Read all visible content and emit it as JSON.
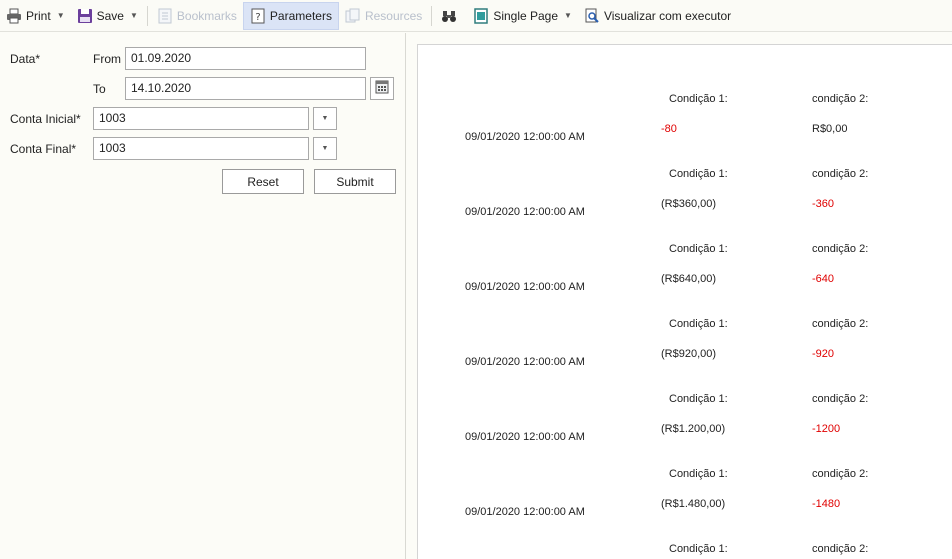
{
  "toolbar": {
    "print": "Print",
    "save": "Save",
    "bookmarks": "Bookmarks",
    "parameters": "Parameters",
    "resources": "Resources",
    "single_page": "Single Page",
    "run": "Visualizar com executor"
  },
  "params": {
    "data_label": "Data*",
    "from_label": "From",
    "from_value": "01.09.2020",
    "to_label": "To",
    "to_value": "14.10.2020",
    "conta_inicial_label": "Conta Inicial*",
    "conta_inicial_value": "1003",
    "conta_final_label": "Conta Final*",
    "conta_final_value": "1003",
    "reset": "Reset",
    "submit": "Submit"
  },
  "report": {
    "cond1_label": "Condição 1:",
    "cond2_label": "condição 2:",
    "rows": [
      {
        "date": "09/01/2020 12:00:00 AM",
        "cond1": "-80",
        "cond1_neg": true,
        "cond2": "R$0,00",
        "cond2_neg": false
      },
      {
        "date": "09/01/2020 12:00:00 AM",
        "cond1": "(R$360,00)",
        "cond1_neg": false,
        "cond2": "-360",
        "cond2_neg": true
      },
      {
        "date": "09/01/2020 12:00:00 AM",
        "cond1": "(R$640,00)",
        "cond1_neg": false,
        "cond2": "-640",
        "cond2_neg": true
      },
      {
        "date": "09/01/2020 12:00:00 AM",
        "cond1": "(R$920,00)",
        "cond1_neg": false,
        "cond2": "-920",
        "cond2_neg": true
      },
      {
        "date": "09/01/2020 12:00:00 AM",
        "cond1": "(R$1.200,00)",
        "cond1_neg": false,
        "cond2": "-1200",
        "cond2_neg": true
      },
      {
        "date": "09/01/2020 12:00:00 AM",
        "cond1": "(R$1.480,00)",
        "cond1_neg": false,
        "cond2": "-1480",
        "cond2_neg": true
      }
    ],
    "trailing_cond1": "Condição 1:",
    "trailing_cond2": "condição 2:"
  },
  "colors": {
    "negative": "#e00000",
    "active_tab": "#dbe4f6",
    "background": "#fcfcf7"
  },
  "icons": [
    "printer-icon",
    "floppy-icon",
    "bookmark-icon",
    "question-page-icon",
    "resources-icon",
    "binoculars-icon",
    "single-page-icon",
    "page-magnifier-icon",
    "calendar-icon",
    "dropdown-arrow-icon"
  ]
}
